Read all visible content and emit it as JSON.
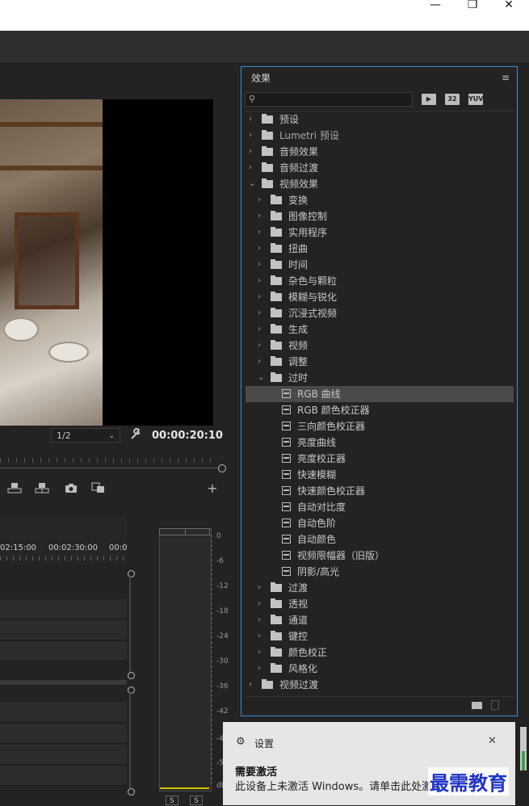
{
  "window": {
    "minimize": "—",
    "maximize": "❐",
    "close": "✕"
  },
  "monitor": {
    "zoom": "1/2",
    "timecode": "00:00:20:10",
    "add": "+"
  },
  "timeline": {
    "ruler": [
      "02:15:00",
      "00:02:30:00",
      "00:0"
    ]
  },
  "meter": {
    "db_labels": [
      "0",
      "-6",
      "-12",
      "-18",
      "-24",
      "-30",
      "-36",
      "-42",
      "-4",
      "-5",
      "dB"
    ],
    "solo": [
      "S",
      "S"
    ]
  },
  "effects": {
    "title": "效果",
    "menu": "≡",
    "search_placeholder": "",
    "badges": [
      "▶",
      "32",
      "YUV"
    ],
    "tree": [
      {
        "label": "预设",
        "level": 0,
        "kind": "preset-folder",
        "expanded": false
      },
      {
        "label": "Lumetri 预设",
        "level": 0,
        "kind": "preset-folder",
        "expanded": false
      },
      {
        "label": "音频效果",
        "level": 0,
        "kind": "folder",
        "expanded": false
      },
      {
        "label": "音频过渡",
        "level": 0,
        "kind": "folder",
        "expanded": false
      },
      {
        "label": "视频效果",
        "level": 0,
        "kind": "folder",
        "expanded": true
      },
      {
        "label": "变换",
        "level": 1,
        "kind": "folder",
        "expanded": false
      },
      {
        "label": "图像控制",
        "level": 1,
        "kind": "folder",
        "expanded": false
      },
      {
        "label": "实用程序",
        "level": 1,
        "kind": "folder",
        "expanded": false
      },
      {
        "label": "扭曲",
        "level": 1,
        "kind": "folder",
        "expanded": false
      },
      {
        "label": "时间",
        "level": 1,
        "kind": "folder",
        "expanded": false
      },
      {
        "label": "杂色与颗粒",
        "level": 1,
        "kind": "folder",
        "expanded": false
      },
      {
        "label": "模糊与锐化",
        "level": 1,
        "kind": "folder",
        "expanded": false
      },
      {
        "label": "沉浸式视频",
        "level": 1,
        "kind": "folder",
        "expanded": false
      },
      {
        "label": "生成",
        "level": 1,
        "kind": "folder",
        "expanded": false
      },
      {
        "label": "视频",
        "level": 1,
        "kind": "folder",
        "expanded": false
      },
      {
        "label": "调整",
        "level": 1,
        "kind": "folder",
        "expanded": false
      },
      {
        "label": "过时",
        "level": 1,
        "kind": "folder",
        "expanded": true
      },
      {
        "label": "RGB 曲线",
        "level": 2,
        "kind": "effect",
        "selected": true
      },
      {
        "label": "RGB 颜色校正器",
        "level": 2,
        "kind": "effect"
      },
      {
        "label": "三向颜色校正器",
        "level": 2,
        "kind": "effect"
      },
      {
        "label": "亮度曲线",
        "level": 2,
        "kind": "effect"
      },
      {
        "label": "亮度校正器",
        "level": 2,
        "kind": "effect"
      },
      {
        "label": "快速模糊",
        "level": 2,
        "kind": "effect"
      },
      {
        "label": "快速颜色校正器",
        "level": 2,
        "kind": "effect"
      },
      {
        "label": "自动对比度",
        "level": 2,
        "kind": "effect"
      },
      {
        "label": "自动色阶",
        "level": 2,
        "kind": "effect"
      },
      {
        "label": "自动颜色",
        "level": 2,
        "kind": "effect"
      },
      {
        "label": "视频限幅器（旧版）",
        "level": 2,
        "kind": "effect"
      },
      {
        "label": "阴影/高光",
        "level": 2,
        "kind": "effect"
      },
      {
        "label": "过渡",
        "level": 1,
        "kind": "folder",
        "expanded": false
      },
      {
        "label": "透视",
        "level": 1,
        "kind": "folder",
        "expanded": false
      },
      {
        "label": "通道",
        "level": 1,
        "kind": "folder",
        "expanded": false
      },
      {
        "label": "键控",
        "level": 1,
        "kind": "folder",
        "expanded": false
      },
      {
        "label": "颜色校正",
        "level": 1,
        "kind": "folder",
        "expanded": false
      },
      {
        "label": "风格化",
        "level": 1,
        "kind": "folder",
        "expanded": false
      },
      {
        "label": "视频过渡",
        "level": 0,
        "kind": "folder",
        "expanded": false
      }
    ]
  },
  "toast": {
    "gear": "⚙",
    "title": "设置",
    "close": "✕",
    "heading": "需要激活",
    "body": "此设备上未激活 Windows。请单击此处激活页"
  },
  "watermark": "最需教育"
}
